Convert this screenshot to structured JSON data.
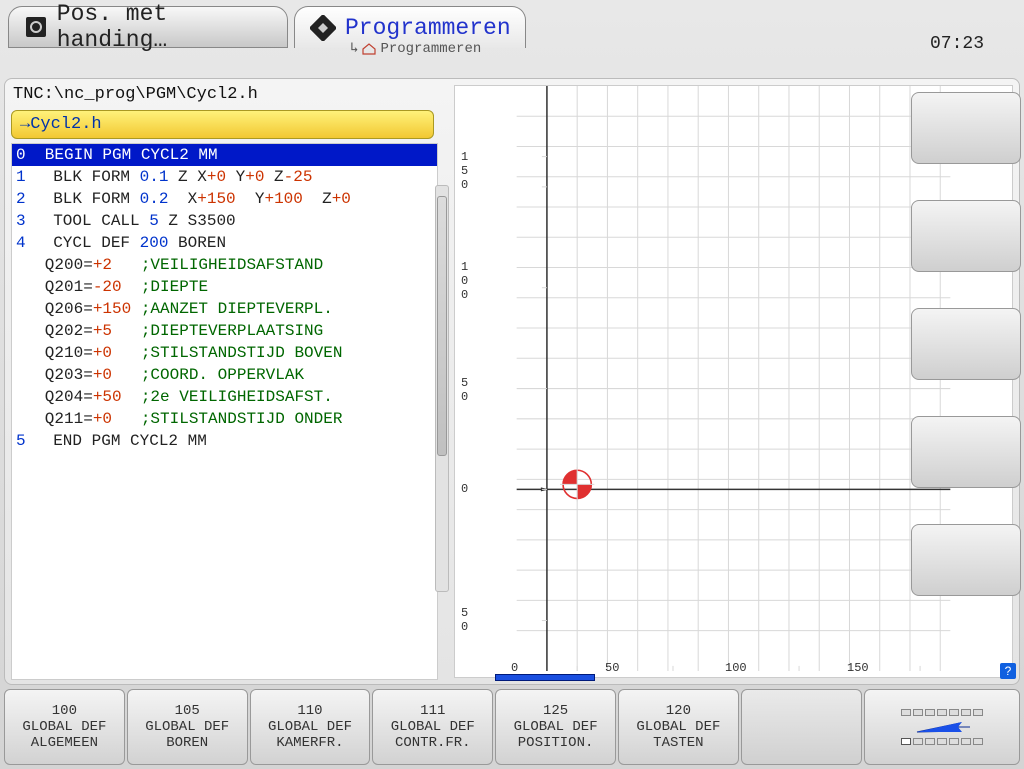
{
  "header": {
    "inactive_tab": "Pos. met handing…",
    "active_tab": "Programmeren",
    "breadcrumb": "Programmeren",
    "clock": "07:23"
  },
  "path": "TNC:\\nc_prog\\PGM\\Cycl2.h",
  "file_tab": "→Cycl2.h",
  "code": {
    "l0": "0  BEGIN PGM CYCL2 MM",
    "l1_n": "1",
    "l1_a": "BLK FORM ",
    "l1_b": "0.1",
    "l1_c": " Z X",
    "l1_d": "+0",
    "l1_e": " Y",
    "l1_f": "+0",
    "l1_g": " Z",
    "l1_h": "-25",
    "l2_n": "2",
    "l2_a": "BLK FORM ",
    "l2_b": "0.2",
    "l2_c": "  X",
    "l2_d": "+150",
    "l2_e": "  Y",
    "l2_f": "+100",
    "l2_g": "  Z",
    "l2_h": "+0",
    "l3_n": "3",
    "l3_a": "TOOL CALL ",
    "l3_b": "5",
    "l3_c": " Z S3500",
    "l4_n": "4",
    "l4_a": "CYCL DEF ",
    "l4_b": "200",
    "l4_c": " BOREN",
    "q200_a": "   Q200=",
    "q200_b": "+2",
    "q200_c": "   ;VEILIGHEIDSAFSTAND",
    "q201_a": "   Q201=",
    "q201_b": "-20",
    "q201_c": "  ;DIEPTE",
    "q206_a": "   Q206=",
    "q206_b": "+150",
    "q206_c": " ;AANZET DIEPTEVERPL.",
    "q202_a": "   Q202=",
    "q202_b": "+5",
    "q202_c": "   ;DIEPTEVERPLAATSING",
    "q210_a": "   Q210=",
    "q210_b": "+0",
    "q210_c": "   ;STILSTANDSTIJD BOVEN",
    "q203_a": "   Q203=",
    "q203_b": "+0",
    "q203_c": "   ;COORD. OPPERVLAK",
    "q204_a": "   Q204=",
    "q204_b": "+50",
    "q204_c": "  ;2e VEILIGHEIDSAFST.",
    "q211_a": "   Q211=",
    "q211_b": "+0",
    "q211_c": "   ;STILSTANDSTIJD ONDER",
    "l5_n": "5",
    "l5_a": "END PGM CYCL2 MM"
  },
  "graph": {
    "y_ticks": [
      "1",
      "5",
      "0",
      "1",
      "0",
      "0",
      "5",
      "0",
      "0",
      "5",
      "0"
    ],
    "x_ticks": [
      "0",
      "50",
      "100",
      "150"
    ],
    "x_first": "0"
  },
  "softkeys": {
    "k0_a": "100",
    "k0_b": "GLOBAL DEF",
    "k0_c": "ALGEMEEN",
    "k1_a": "105",
    "k1_b": "GLOBAL DEF",
    "k1_c": "BOREN",
    "k2_a": "110",
    "k2_b": "GLOBAL DEF",
    "k2_c": "KAMERFR.",
    "k3_a": "111",
    "k3_b": "GLOBAL DEF",
    "k3_c": "CONTR.FR.",
    "k4_a": "125",
    "k4_b": "GLOBAL DEF",
    "k4_c": "POSITION.",
    "k5_a": "120",
    "k5_b": "GLOBAL DEF",
    "k5_c": "TASTEN"
  },
  "help": "?"
}
